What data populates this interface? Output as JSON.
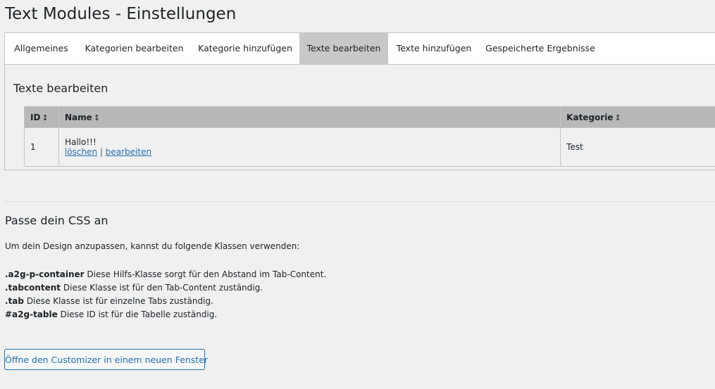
{
  "page": {
    "title": "Text Modules - Einstellungen"
  },
  "tabs": [
    {
      "label": "Allgemeines",
      "active": false
    },
    {
      "label": "Kategorien bearbeiten",
      "active": false
    },
    {
      "label": "Kategorie hinzufügen",
      "active": false
    },
    {
      "label": "Texte bearbeiten",
      "active": true
    },
    {
      "label": "Texte hinzufügen",
      "active": false
    },
    {
      "label": "Gespeicherte Ergebnisse",
      "active": false
    }
  ],
  "section": {
    "title": "Texte bearbeiten"
  },
  "table": {
    "columns": [
      "ID",
      "Name",
      "Kategorie"
    ],
    "sort_glyph": "↕",
    "rows": [
      {
        "id": "1",
        "name": "Hallo!!!",
        "delete_label": "löschen",
        "separator": "|",
        "edit_label": "bearbeiten",
        "category": "Test"
      }
    ]
  },
  "css_section": {
    "title": "Passe dein CSS an",
    "intro": "Um dein Design anzupassen, kannst du folgende Klassen verwenden:",
    "classes": [
      {
        "name": ".a2g-p-container",
        "description": "Diese Hilfs-Klasse sorgt für den Abstand im Tab-Content."
      },
      {
        "name": ".tabcontent",
        "description": "Diese Klasse ist für den Tab-Content zuständig."
      },
      {
        "name": ".tab",
        "description": "Diese Klasse ist für einzelne Tabs zuständig."
      },
      {
        "name": "#a2g-table",
        "description": "Diese ID ist für die Tabelle zuständig."
      }
    ],
    "button_label": "Öffne den Customizer in einem neuen Fenster"
  },
  "colors": {
    "background": "#f0f0f1",
    "active_tab": "#c8c8c9",
    "table_header": "#b8b8b8",
    "link": "#2271b1"
  }
}
